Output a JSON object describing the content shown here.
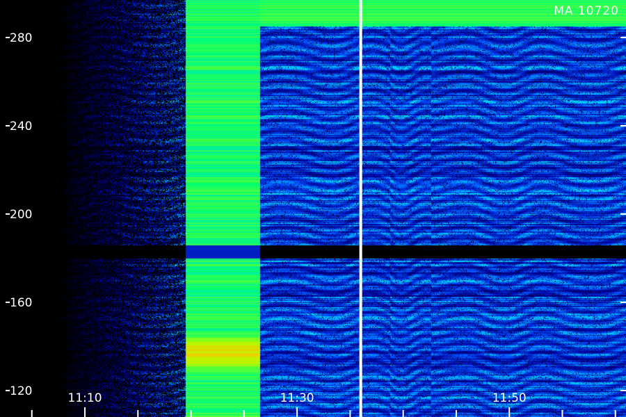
{
  "chart_data": {
    "type": "heatmap",
    "title": "",
    "corner_label": "MA 10720",
    "xlabel": "",
    "ylabel": "",
    "x_ticks": [
      "11:10",
      "11:30",
      "11:50"
    ],
    "x_tick_minutes": [
      10,
      30,
      50
    ],
    "x_range_minutes": [
      2,
      61
    ],
    "y_ticks": [
      "120",
      "160",
      "200",
      "240",
      "280"
    ],
    "y_tick_values": [
      120,
      160,
      200,
      240,
      280
    ],
    "y_range": [
      108,
      297
    ],
    "data_gaps_y": [
      [
        180,
        186
      ]
    ],
    "events": [
      {
        "type": "saturated-band",
        "x_start_minutes": 19.5,
        "x_end_minutes": 26.5
      },
      {
        "type": "vertical-marker",
        "x_minutes": 36
      }
    ],
    "colorscale": [
      "#000000",
      "#0000a0",
      "#0050ff",
      "#00d0ff",
      "#00ff70",
      "#b0ff00",
      "#ffc000",
      "#ff2000"
    ],
    "grid": false
  }
}
